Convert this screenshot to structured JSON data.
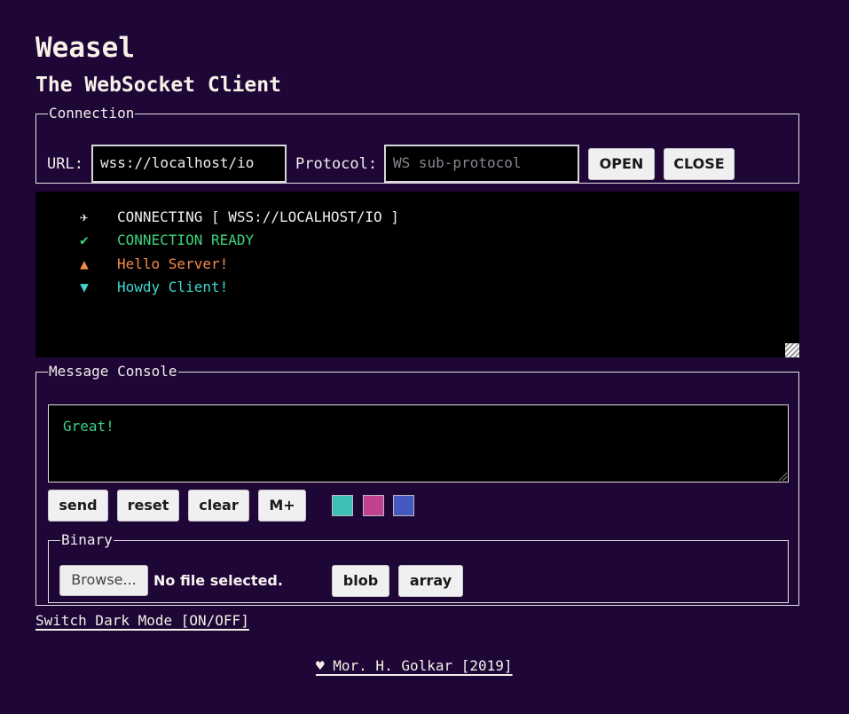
{
  "app": {
    "title": "Weasel",
    "subtitle": "The WebSocket Client"
  },
  "connection": {
    "legend": "Connection",
    "url_label": "URL:",
    "url_value": "wss://localhost/io",
    "protocol_label": "Protocol:",
    "protocol_placeholder": "WS sub-protocol",
    "open_label": "OPEN",
    "close_label": "CLOSE"
  },
  "log": {
    "entries": [
      {
        "icon": "✈",
        "icon_name": "plane-icon",
        "text": "CONNECTING [ WSS://LOCALHOST/IO ]",
        "color": "#f2eeea"
      },
      {
        "icon": "✔",
        "icon_name": "check-icon",
        "text": "CONNECTION READY",
        "color": "#3fd37c"
      },
      {
        "icon": "▲",
        "icon_name": "up-triangle-icon",
        "text": "Hello Server!",
        "color": "#f28a4a"
      },
      {
        "icon": "▼",
        "icon_name": "down-triangle-icon",
        "text": "Howdy Client!",
        "color": "#3fd6d0"
      }
    ]
  },
  "console": {
    "legend": "Message Console",
    "message": "Great!",
    "send_label": "send",
    "reset_label": "reset",
    "clear_label": "clear",
    "mplus_label": "M+",
    "swatches": [
      "#3dbfb4",
      "#c0428f",
      "#4458c0"
    ]
  },
  "binary": {
    "legend": "Binary",
    "browse_label": "Browse...",
    "file_status": "No file selected.",
    "blob_label": "blob",
    "array_label": "array"
  },
  "footer": {
    "dark_mode_link": "Switch Dark Mode [ON/OFF]",
    "credit": "♥ Mor. H. Golkar [2019]"
  }
}
